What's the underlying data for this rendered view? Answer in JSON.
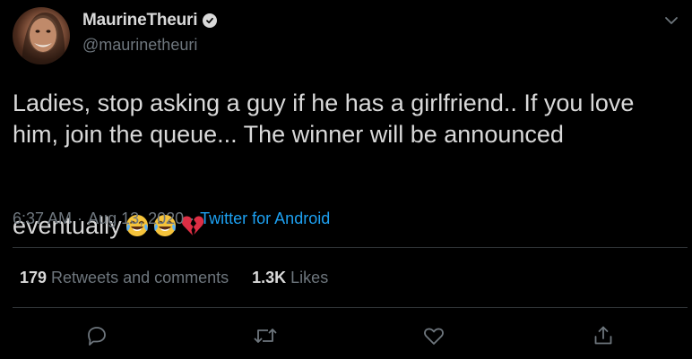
{
  "user": {
    "display_name": "MaurineTheuri",
    "handle": "@maurinetheuri",
    "verified_icon": "verified-badge-icon"
  },
  "tweet": {
    "text": "Ladies, stop asking a guy if he has a girlfriend.. If you love him, join the queue... The winner will be announced eventually",
    "emojis": [
      "face-with-tears-of-joy",
      "face-with-tears-of-joy",
      "broken-heart"
    ],
    "time": "6:37 AM",
    "separator1": "·",
    "date": "Aug 13, 2020",
    "separator2": "·",
    "source": "Twitter for Android"
  },
  "stats": {
    "retweets_count": "179",
    "retweets_label": "Retweets and comments",
    "likes_count": "1.3K",
    "likes_label": "Likes"
  },
  "actions": [
    "reply-icon",
    "retweet-icon",
    "like-icon",
    "share-icon"
  ],
  "colors": {
    "background": "#000000",
    "text": "#d9d9d9",
    "muted": "#6e767d",
    "link": "#1da1f2",
    "divider": "#2f3336"
  }
}
